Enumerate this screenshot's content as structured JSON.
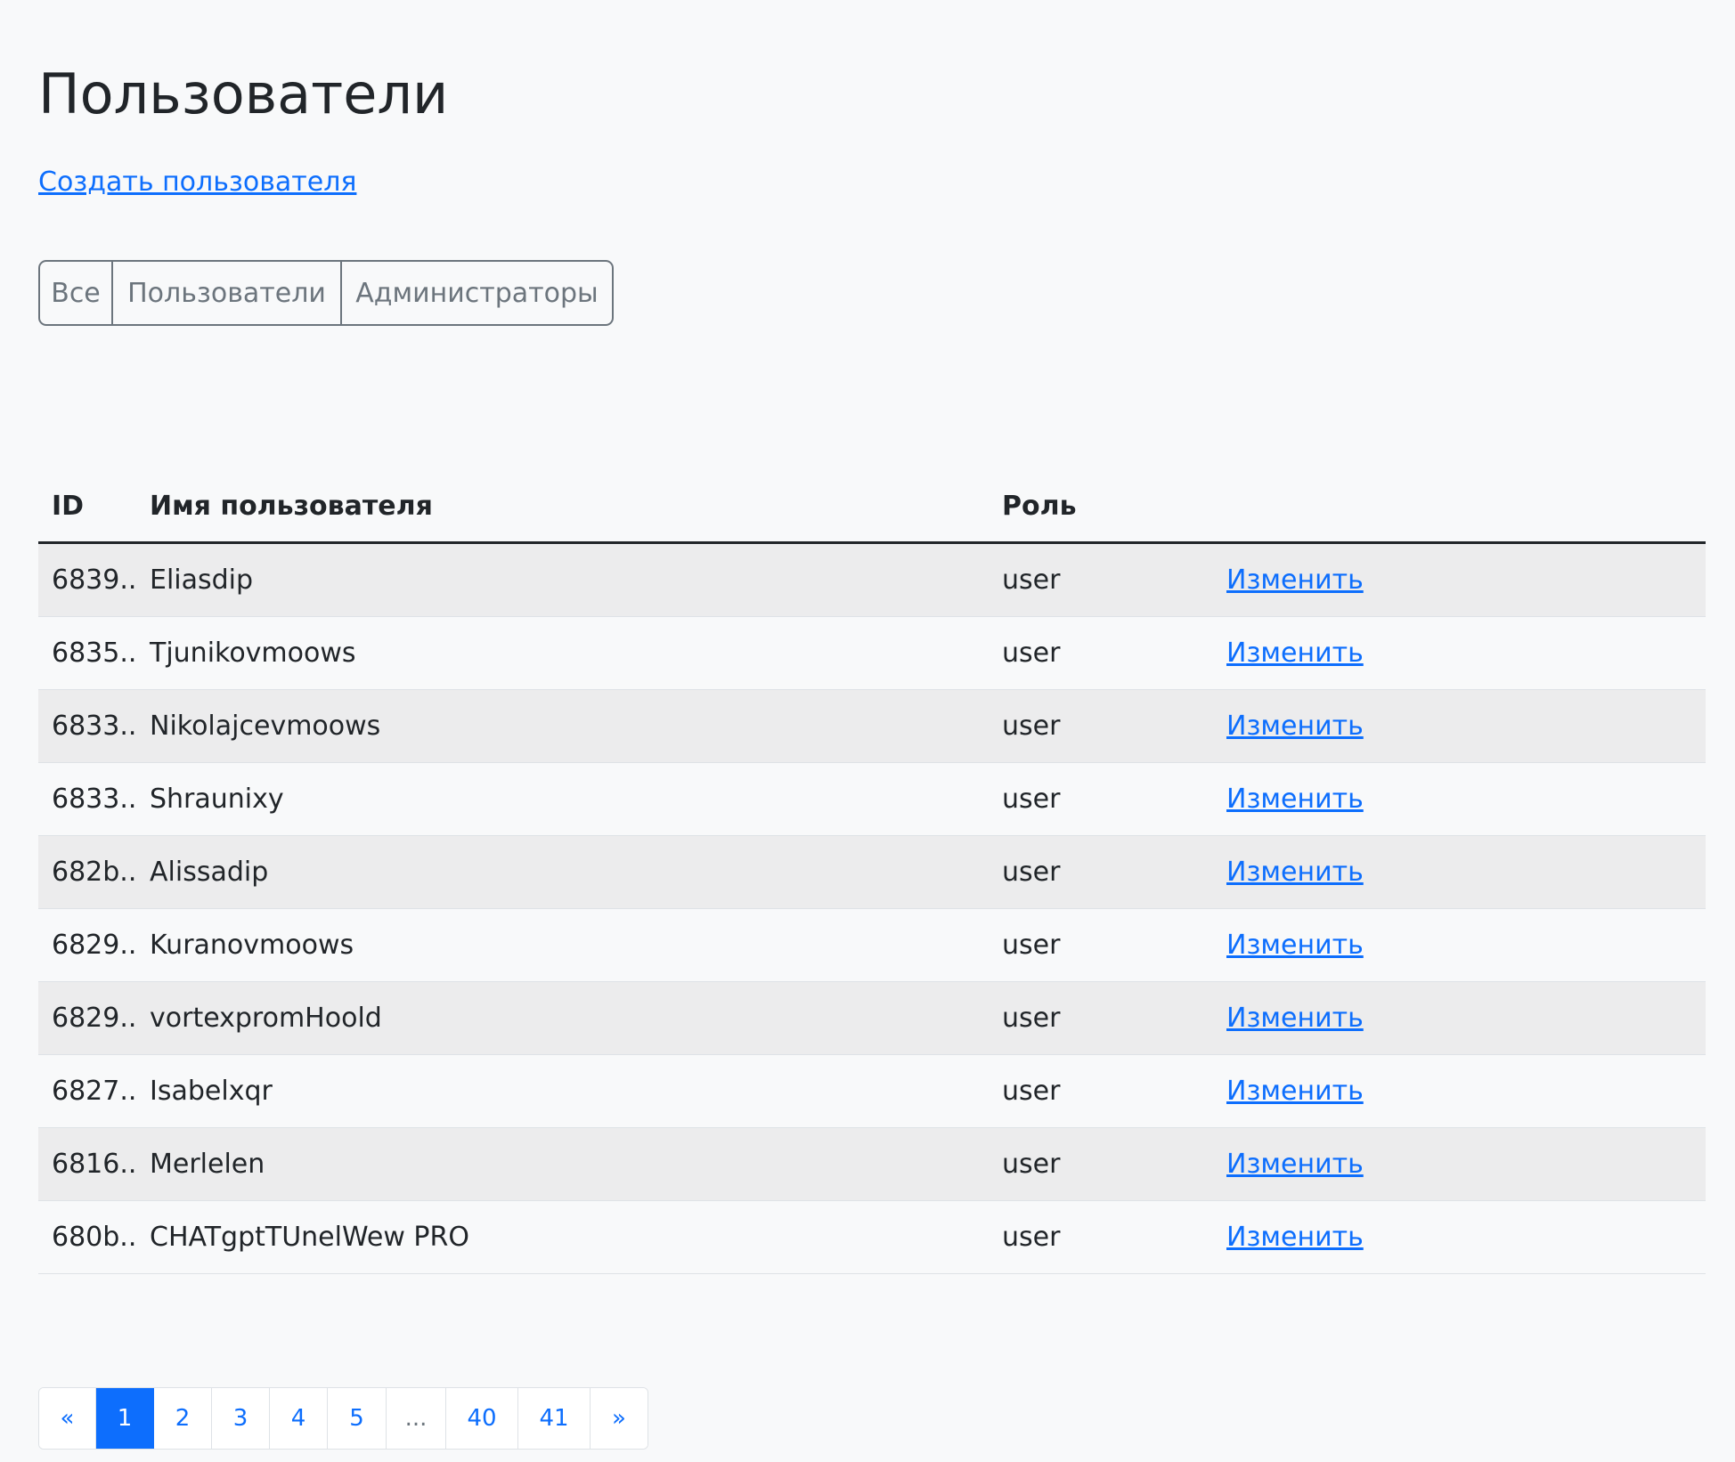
{
  "page": {
    "title": "Пользователи",
    "create_link": "Создать пользователя"
  },
  "filters": [
    {
      "label": "Все"
    },
    {
      "label": "Пользователи"
    },
    {
      "label": "Администраторы"
    }
  ],
  "table": {
    "headers": [
      "ID",
      "Имя пользователя",
      "Роль",
      ""
    ],
    "rows": [
      {
        "id": "6839...",
        "name": "Eliasdip",
        "role": "user",
        "action": "Изменить"
      },
      {
        "id": "6835...",
        "name": "Tjunikovmoows",
        "role": "user",
        "action": "Изменить"
      },
      {
        "id": "6833...",
        "name": "Nikolajcevmoows",
        "role": "user",
        "action": "Изменить"
      },
      {
        "id": "6833...",
        "name": "Shraunixy",
        "role": "user",
        "action": "Изменить"
      },
      {
        "id": "682b...",
        "name": "Alissadip",
        "role": "user",
        "action": "Изменить"
      },
      {
        "id": "6829...",
        "name": "Kuranovmoows",
        "role": "user",
        "action": "Изменить"
      },
      {
        "id": "6829...",
        "name": "vortexpromHoold",
        "role": "user",
        "action": "Изменить"
      },
      {
        "id": "6827...",
        "name": "Isabelxqr",
        "role": "user",
        "action": "Изменить"
      },
      {
        "id": "6816...",
        "name": "Merlelen",
        "role": "user",
        "action": "Изменить"
      },
      {
        "id": "680b...",
        "name": "CHATgptTUnelWew PRO",
        "role": "user",
        "action": "Изменить"
      }
    ]
  },
  "pagination": {
    "items": [
      {
        "label": "«",
        "state": "normal"
      },
      {
        "label": "1",
        "state": "active"
      },
      {
        "label": "2",
        "state": "normal"
      },
      {
        "label": "3",
        "state": "normal"
      },
      {
        "label": "4",
        "state": "normal"
      },
      {
        "label": "5",
        "state": "normal"
      },
      {
        "label": "...",
        "state": "disabled"
      },
      {
        "label": "40",
        "state": "normal"
      },
      {
        "label": "41",
        "state": "normal"
      },
      {
        "label": "»",
        "state": "normal"
      }
    ]
  },
  "colors": {
    "background": "#f8f9fa",
    "text": "#212529",
    "link": "#0d6efd",
    "stripe": "#ececed",
    "border": "#dee2e6",
    "secondary": "#6c757d"
  }
}
